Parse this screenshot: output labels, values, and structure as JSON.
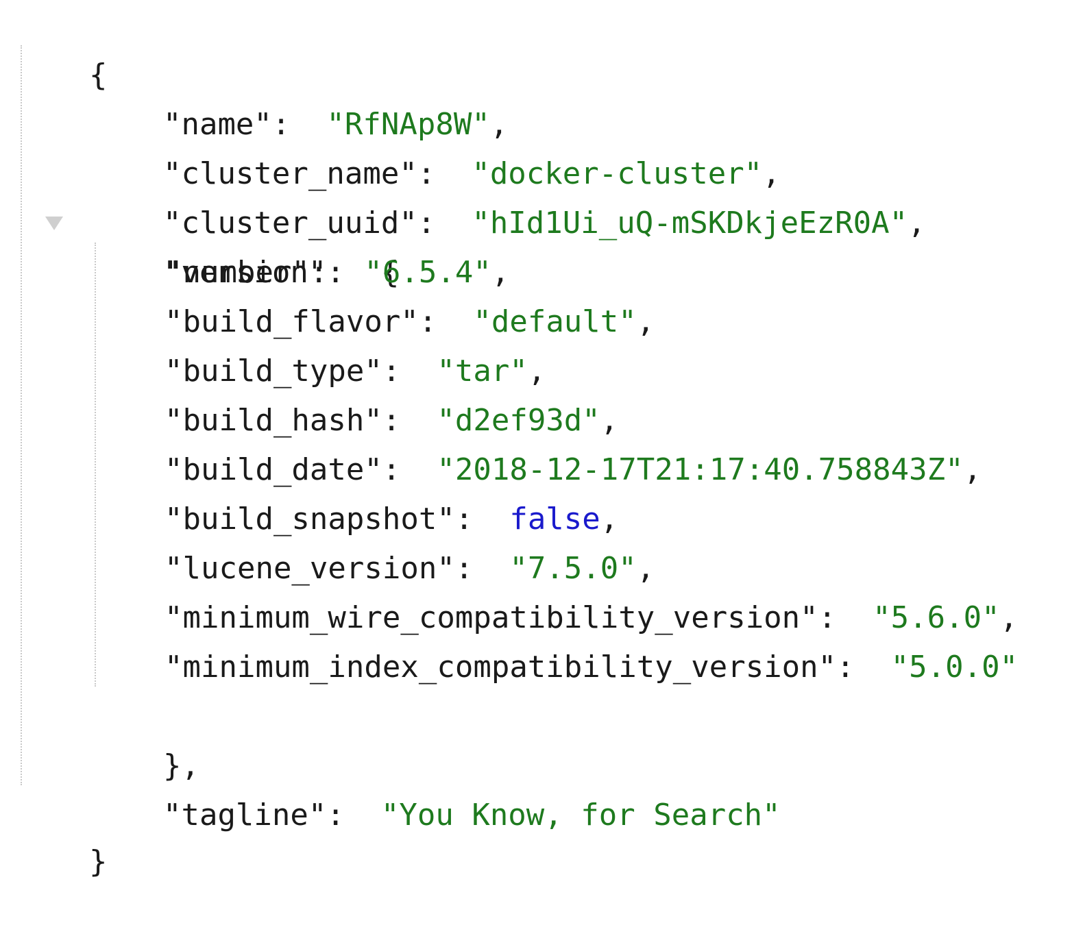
{
  "json_viewer": {
    "open_brace": "{",
    "close_brace": "}",
    "name": {
      "key": "\"name\"",
      "value": "\"RfNAp8W\""
    },
    "cluster_name": {
      "key": "\"cluster_name\"",
      "value": "\"docker-cluster\""
    },
    "cluster_uuid": {
      "key": "\"cluster_uuid\"",
      "value": "\"hId1Ui_uQ-mSKDkjeEzR0A\""
    },
    "version": {
      "key": "\"version\"",
      "open_brace": "{",
      "close_brace": "}",
      "toggle_icon": "collapse-triangle-icon",
      "fields": [
        {
          "key": "\"number\"",
          "value": "\"6.5.4\"",
          "type": "string",
          "comma": ","
        },
        {
          "key": "\"build_flavor\"",
          "value": "\"default\"",
          "type": "string",
          "comma": ","
        },
        {
          "key": "\"build_type\"",
          "value": "\"tar\"",
          "type": "string",
          "comma": ","
        },
        {
          "key": "\"build_hash\"",
          "value": "\"d2ef93d\"",
          "type": "string",
          "comma": ","
        },
        {
          "key": "\"build_date\"",
          "value": "\"2018-12-17T21:17:40.758843Z\"",
          "type": "string",
          "comma": ","
        },
        {
          "key": "\"build_snapshot\"",
          "value": "false",
          "type": "boolean",
          "comma": ","
        },
        {
          "key": "\"lucene_version\"",
          "value": "\"7.5.0\"",
          "type": "string",
          "comma": ","
        },
        {
          "key": "\"minimum_wire_compatibility_version\"",
          "value": "\"5.6.0\"",
          "type": "string",
          "comma": ","
        },
        {
          "key": "\"minimum_index_compatibility_version\"",
          "value": "\"5.0.0\"",
          "type": "string",
          "comma": ""
        }
      ]
    },
    "tagline": {
      "key": "\"tagline\"",
      "value": "\"You Know, for Search\""
    },
    "separator": ": ",
    "comma": ",",
    "colors": {
      "key": "#1a1a1a",
      "string": "#1e7a1e",
      "boolean": "#1a1acc",
      "guide": "#c8c8c8",
      "toggle": "#cfcfcf"
    }
  }
}
